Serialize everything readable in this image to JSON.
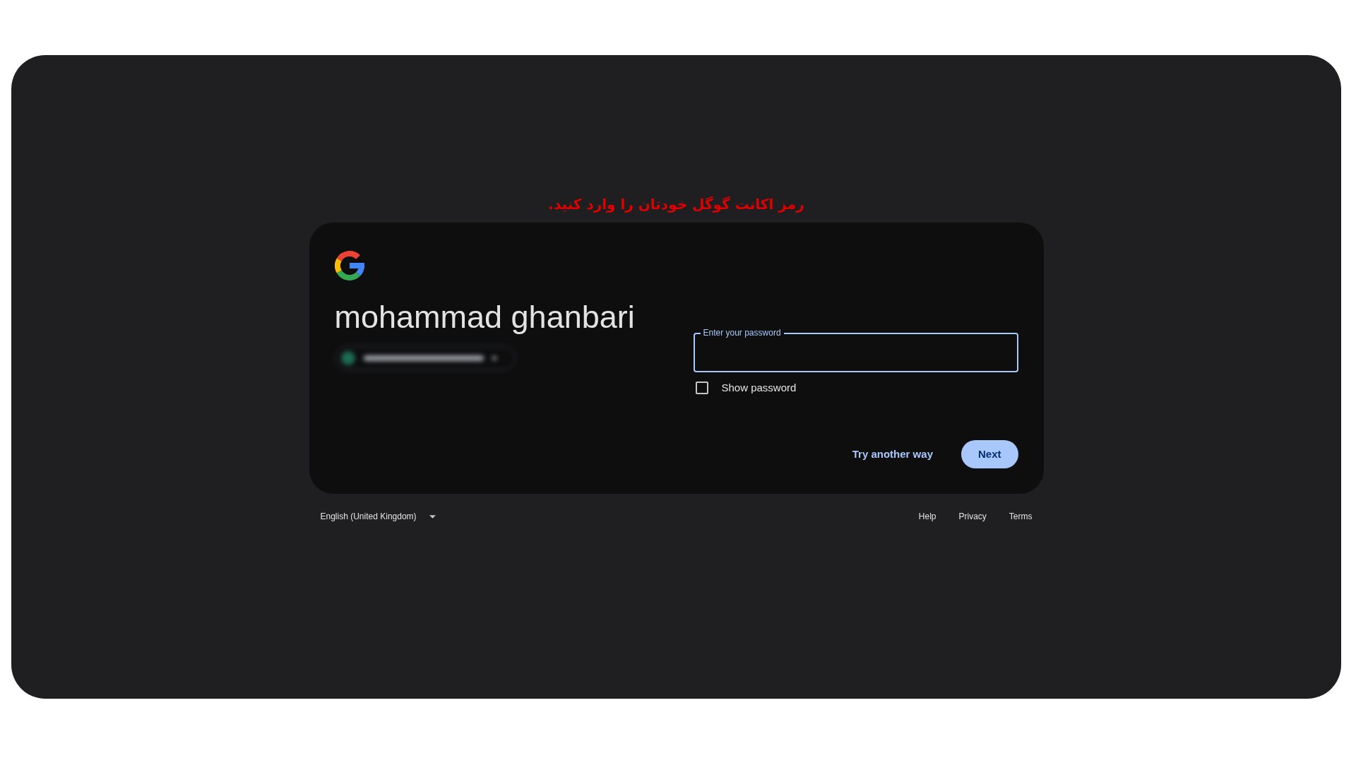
{
  "instruction": "رمز اکانت گوگل خودتان را وارد کنید.",
  "card": {
    "name": "mohammad ghanbari",
    "password_field": {
      "label": "Enter your password",
      "focused": true
    },
    "show_password": {
      "label": "Show password",
      "checked": false
    },
    "buttons": [
      {
        "label": "Try another way",
        "kind": "text"
      },
      {
        "label": "Next",
        "kind": "filled"
      }
    ]
  },
  "footer": {
    "language": "English (United Kingdom)",
    "links": [
      "Help",
      "Privacy",
      "Terms"
    ]
  }
}
